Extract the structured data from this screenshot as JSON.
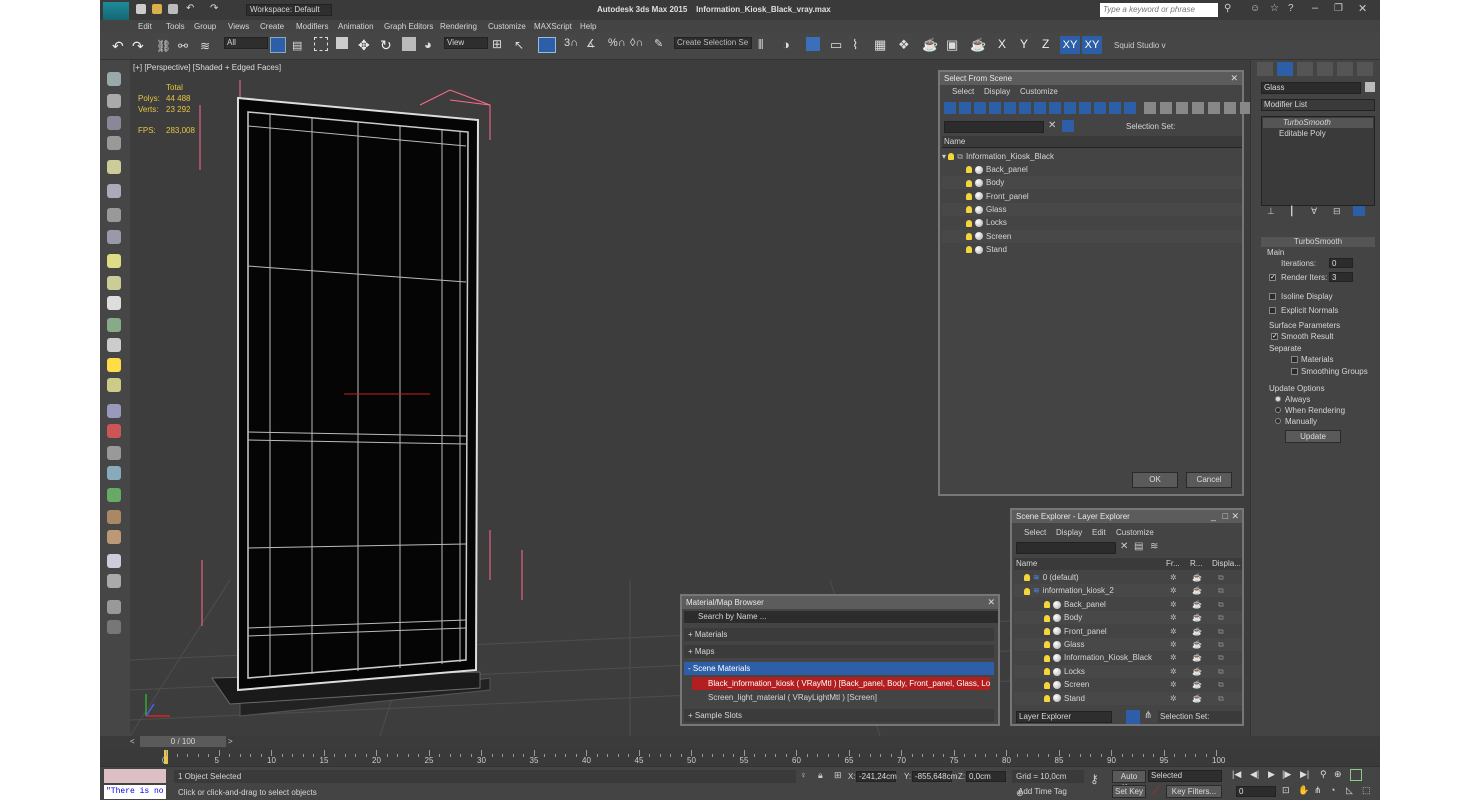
{
  "titlebar": {
    "app": "Autodesk 3ds Max  2015",
    "file": "Information_Kiosk_Black_vray.max",
    "workspace": "Workspace: Default",
    "search_placeholder": "Type a keyword or phrase"
  },
  "menu": [
    "Edit",
    "Tools",
    "Group",
    "Views",
    "Create",
    "Modifiers",
    "Animation",
    "Graph Editors",
    "Rendering",
    "Customize",
    "MAXScript",
    "Help"
  ],
  "toolbar": {
    "filter": "All",
    "view": "View",
    "selection_set": "Create Selection Se",
    "axes": [
      "X",
      "Y",
      "Z",
      "XY",
      "XY"
    ],
    "squid": "Squid Studio v"
  },
  "viewport": {
    "label": "[+] [Perspective] [Shaded + Edged Faces]",
    "stats": {
      "total": "Total",
      "polys_label": "Polys:",
      "polys": "44 488",
      "verts_label": "Verts:",
      "verts": "23 292",
      "fps_label": "FPS:",
      "fps": "283,008"
    }
  },
  "select_from_scene": {
    "title": "Select From Scene",
    "menu": [
      "Select",
      "Display",
      "Customize"
    ],
    "selection_set": "Selection Set:",
    "col_name": "Name",
    "root": "Information_Kiosk_Black",
    "items": [
      "Back_panel",
      "Body",
      "Front_panel",
      "Glass",
      "Locks",
      "Screen",
      "Stand"
    ],
    "ok": "OK",
    "cancel": "Cancel"
  },
  "scene_explorer": {
    "title": "Scene Explorer - Layer Explorer",
    "menu": [
      "Select",
      "Display",
      "Edit",
      "Customize"
    ],
    "cols": [
      "Name",
      "Fr...",
      "R...",
      "Displa..."
    ],
    "rows": [
      "0 (default)",
      "information_kiosk_2",
      "Back_panel",
      "Body",
      "Front_panel",
      "Glass",
      "Information_Kiosk_Black",
      "Locks",
      "Screen",
      "Stand"
    ],
    "footer_left": "Layer Explorer",
    "footer_right": "Selection Set:"
  },
  "material_browser": {
    "title": "Material/Map Browser",
    "search": "Search by Name ...",
    "sections": [
      "+ Materials",
      "+ Maps",
      "- Scene Materials",
      "+ Sample Slots"
    ],
    "items": [
      "Black_information_kiosk  ( VRayMtl )  [Back_panel, Body, Front_panel, Glass, Loc...",
      "Screen_light_material  ( VRayLightMtl )  [Screen]"
    ]
  },
  "command_panel": {
    "object": "Glass",
    "modifier_list": "Modifier List",
    "stack": [
      "TurboSmooth",
      "Editable Poly"
    ],
    "rollout": "TurboSmooth",
    "main": "Main",
    "iterations_label": "Iterations:",
    "iterations": "0",
    "render_iters_label": "Render Iters:",
    "render_iters": "3",
    "isoline": "Isoline Display",
    "explicit": "Explicit Normals",
    "surface": "Surface Parameters",
    "smooth": "Smooth Result",
    "separate": "Separate",
    "materials": "Materials",
    "smoothing": "Smoothing Groups",
    "update_options": "Update Options",
    "always": "Always",
    "when_rendering": "When Rendering",
    "manually": "Manually",
    "update": "Update"
  },
  "timeline": {
    "frame": "0 / 100",
    "ticks": [
      "0",
      "5",
      "10",
      "15",
      "20",
      "25",
      "30",
      "35",
      "40",
      "45",
      "50",
      "55",
      "60",
      "65",
      "70",
      "75",
      "80",
      "85",
      "90",
      "95",
      "100"
    ]
  },
  "status": {
    "script": "\"There is no",
    "selected": "1 Object Selected",
    "prompt": "Click or click-and-drag to select objects",
    "x_label": "X:",
    "x": "-241,24cm",
    "y_label": "Y:",
    "y": "-855,648cm",
    "z_label": "Z:",
    "z": "0,0cm",
    "grid": "Grid = 10,0cm",
    "add_time_tag": "Add Time Tag",
    "auto_key": "Auto Key",
    "set_key": "Set Key",
    "selected_dd": "Selected",
    "key_filters": "Key Filters...",
    "frame_field": "0"
  },
  "colors": {
    "bg": "#444444",
    "viewport": "#3d3d3d",
    "highlight": "#2d5fa8",
    "red_sel": "#b31f1f",
    "yellow": "#e7c640"
  }
}
